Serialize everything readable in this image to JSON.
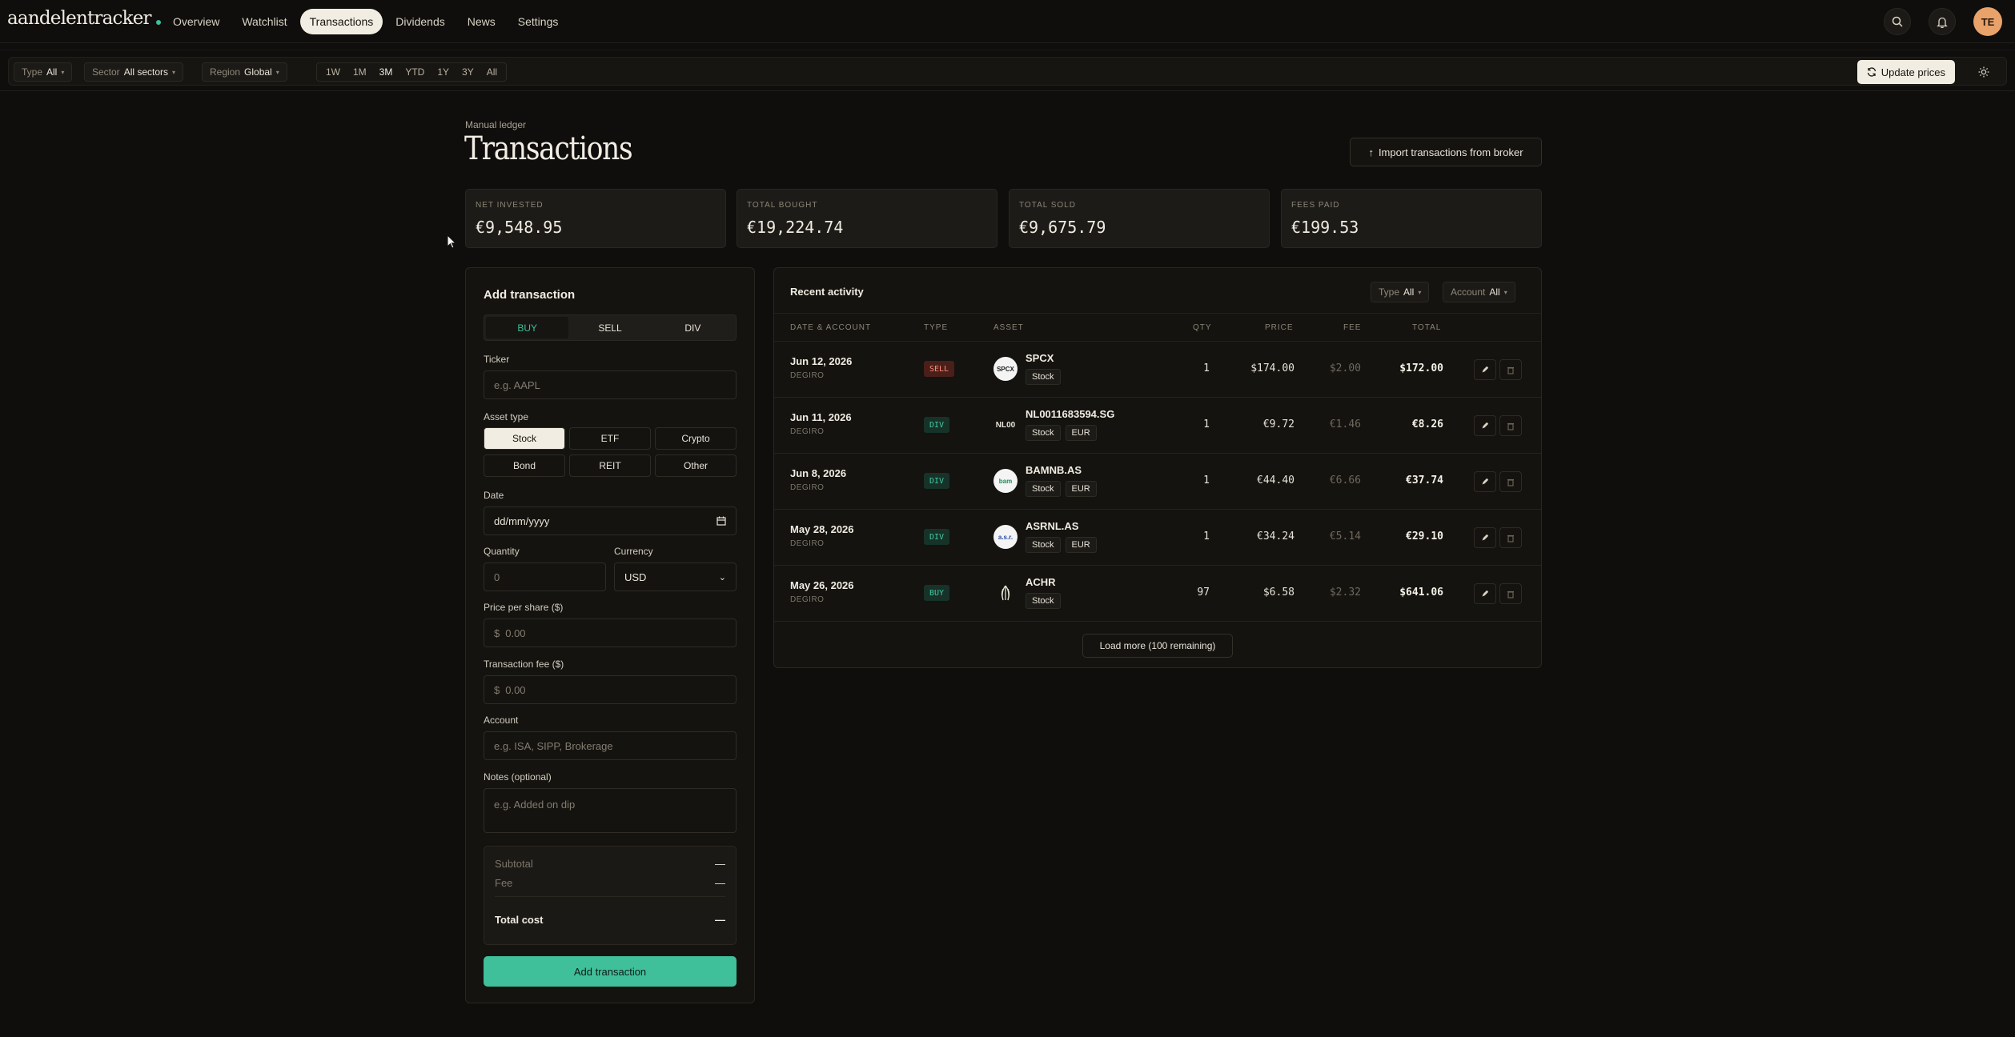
{
  "app": {
    "name": "aandelentracker"
  },
  "nav": {
    "links": [
      "Overview",
      "Watchlist",
      "Transactions",
      "Dividends",
      "News",
      "Settings"
    ],
    "active": "Transactions",
    "avatar_initials": "TE"
  },
  "filters": {
    "type_label": "Type",
    "type_value": "All",
    "sector_label": "Sector",
    "sector_value": "All sectors",
    "region_label": "Region",
    "region_value": "Global",
    "ranges": [
      "1W",
      "1M",
      "3M",
      "YTD",
      "1Y",
      "3Y",
      "All"
    ],
    "active_range": "3M",
    "update_label": "Update prices"
  },
  "header": {
    "eyebrow": "Manual ledger",
    "title": "Transactions",
    "import_label": "Import transactions from broker"
  },
  "stats": [
    {
      "label": "NET INVESTED",
      "value": "€9,548.95"
    },
    {
      "label": "TOTAL BOUGHT",
      "value": "€19,224.74"
    },
    {
      "label": "TOTAL SOLD",
      "value": "€9,675.79"
    },
    {
      "label": "FEES PAID",
      "value": "€199.53"
    }
  ],
  "form": {
    "title": "Add transaction",
    "modes": [
      "BUY",
      "SELL",
      "DIV"
    ],
    "active_mode": "BUY",
    "ticker_label": "Ticker",
    "ticker_placeholder": "e.g. AAPL",
    "asset_type_label": "Asset type",
    "asset_types": [
      "Stock",
      "ETF",
      "Crypto",
      "Bond",
      "REIT",
      "Other"
    ],
    "active_asset_type": "Stock",
    "date_label": "Date",
    "date_placeholder": "dd/mm/yyyy",
    "quantity_label": "Quantity",
    "quantity_placeholder": "0",
    "currency_label": "Currency",
    "currency_value": "USD",
    "price_label": "Price per share ($)",
    "price_prefix": "$",
    "price_placeholder": "0.00",
    "fee_label": "Transaction fee ($)",
    "fee_prefix": "$",
    "fee_placeholder": "0.00",
    "account_label": "Account",
    "account_placeholder": "e.g. ISA, SIPP, Brokerage",
    "notes_label": "Notes (optional)",
    "notes_placeholder": "e.g. Added on dip",
    "summary": {
      "subtotal_label": "Subtotal",
      "subtotal_value": "—",
      "fee_label": "Fee",
      "fee_value": "—",
      "total_label": "Total cost",
      "total_value": "—"
    },
    "submit_label": "Add transaction"
  },
  "activity": {
    "title": "Recent activity",
    "type_filter_label": "Type",
    "type_filter_value": "All",
    "account_filter_label": "Account",
    "account_filter_value": "All",
    "columns": [
      "DATE & ACCOUNT",
      "TYPE",
      "ASSET",
      "QTY",
      "PRICE",
      "FEE",
      "TOTAL"
    ],
    "rows": [
      {
        "date": "Jun 12, 2026",
        "account": "DEGIRO",
        "type": "SELL",
        "logo": "SPCX",
        "ticker": "SPCX",
        "tags": [
          "Stock"
        ],
        "qty": "1",
        "price": "$174.00",
        "fee": "$2.00",
        "total": "$172.00"
      },
      {
        "date": "Jun 11, 2026",
        "account": "DEGIRO",
        "type": "DIV",
        "logo": "NL00",
        "ticker": "NL0011683594.SG",
        "tags": [
          "Stock",
          "EUR"
        ],
        "qty": "1",
        "price": "€9.72",
        "fee": "€1.46",
        "total": "€8.26"
      },
      {
        "date": "Jun 8, 2026",
        "account": "DEGIRO",
        "type": "DIV",
        "logo": "bam",
        "ticker": "BAMNB.AS",
        "tags": [
          "Stock",
          "EUR"
        ],
        "qty": "1",
        "price": "€44.40",
        "fee": "€6.66",
        "total": "€37.74"
      },
      {
        "date": "May 28, 2026",
        "account": "DEGIRO",
        "type": "DIV",
        "logo": "a.s.r.",
        "ticker": "ASRNL.AS",
        "tags": [
          "Stock",
          "EUR"
        ],
        "qty": "1",
        "price": "€34.24",
        "fee": "€5.14",
        "total": "€29.10"
      },
      {
        "date": "May 26, 2026",
        "account": "DEGIRO",
        "type": "BUY",
        "logo": "ACHR",
        "ticker": "ACHR",
        "tags": [
          "Stock"
        ],
        "qty": "97",
        "price": "$6.58",
        "fee": "$2.32",
        "total": "$641.06"
      }
    ],
    "load_more_label": "Load more (100 remaining)"
  },
  "colors": {
    "accent": "#3fbf9a",
    "sell": "#ff8b76",
    "avatar": "#e9a36a",
    "background": "#0f0e0c"
  }
}
